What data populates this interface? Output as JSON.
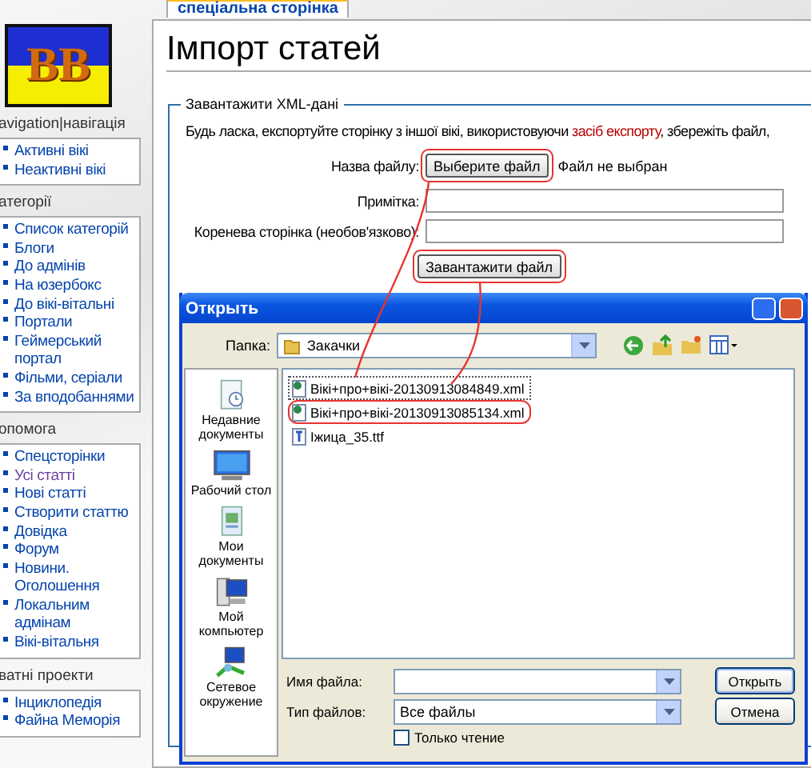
{
  "logo": {
    "text": "BB"
  },
  "sidebar": {
    "sections": [
      {
        "heading": "avigation|навігація",
        "items": [
          {
            "label": "Активні вікі",
            "visited": false
          },
          {
            "label": "Неактивні вікі",
            "visited": false
          }
        ]
      },
      {
        "heading": "атегорії",
        "items": [
          {
            "label": "Список категорій",
            "visited": false
          },
          {
            "label": "Блоги",
            "visited": false
          },
          {
            "label": "До адмінів",
            "visited": false
          },
          {
            "label": "На юзербокс",
            "visited": false
          },
          {
            "label": "До вікі-вітальні",
            "visited": false
          },
          {
            "label": "Портали",
            "visited": false
          },
          {
            "label": "Геймерський портал",
            "visited": false
          },
          {
            "label": "Фільми, серіали",
            "visited": false
          },
          {
            "label": "За вподобаннями",
            "visited": false
          }
        ]
      },
      {
        "heading": "опомога",
        "items": [
          {
            "label": "Спецсторінки",
            "visited": false
          },
          {
            "label": "Усі статті",
            "visited": true
          },
          {
            "label": "Нові статті",
            "visited": false
          },
          {
            "label": "Створити статтю",
            "visited": false
          },
          {
            "label": "Довідка",
            "visited": false
          },
          {
            "label": "Форум",
            "visited": false
          },
          {
            "label": "Новини. Оголошення",
            "visited": false
          },
          {
            "label": "Локальним адмінам",
            "visited": false
          },
          {
            "label": "Вікі-вітальня",
            "visited": false
          }
        ]
      },
      {
        "heading": "ватні проекти",
        "items": [
          {
            "label": "Інциклопедія",
            "visited": false
          },
          {
            "label": "Файна Меморія",
            "visited": false
          }
        ]
      }
    ]
  },
  "tabs": [
    {
      "label": "спеціальна сторінка",
      "selected": true
    }
  ],
  "page": {
    "title": "Імпорт статей",
    "fieldset": {
      "legend": "Завантажити XML-дані",
      "intro": {
        "before": "Будь ласка, експортуйте сторінку з іншої вікі, використовуючи ",
        "link": "засіб експорту",
        "after": ", збережіть файл,"
      },
      "rows": [
        {
          "label": "Назва файлу:",
          "kind": "file",
          "button": "Выберите файл",
          "status": "Файл не выбран",
          "highlighted": true
        },
        {
          "label": "Примітка:",
          "kind": "text"
        },
        {
          "label": "Коренева сторінка (необов'язково):",
          "kind": "text"
        }
      ],
      "submit": {
        "label": "Завантажити файл",
        "highlighted": true
      }
    }
  },
  "dialog": {
    "title": "Открыть",
    "folder_label": "Папка:",
    "folder": "Закачки",
    "places": [
      {
        "label": "Недавние документы",
        "kind": "recent"
      },
      {
        "label": "Рабочий стол",
        "kind": "desktop"
      },
      {
        "label": "Мои документы",
        "kind": "documents"
      },
      {
        "label": "Мой компьютер",
        "kind": "computer"
      },
      {
        "label": "Сетевое окружение",
        "kind": "network"
      }
    ],
    "files": [
      {
        "name": "Вікі+про+вікі-20130913084849.xml",
        "kind": "xml",
        "focused": true,
        "highlighted": false
      },
      {
        "name": "Вікі+про+вікі-20130913085134.xml",
        "kind": "xml",
        "focused": false,
        "highlighted": true
      },
      {
        "name": "Іжица_35.ttf",
        "kind": "font",
        "focused": false,
        "highlighted": false
      }
    ],
    "file_name_label": "Имя файла:",
    "file_type_label": "Тип файлов:",
    "file_type": "Все файлы",
    "read_only": {
      "label": "Только чтение",
      "checked": false
    },
    "buttons": [
      {
        "label": "Открыть",
        "default": true
      },
      {
        "label": "Отмена",
        "default": false
      }
    ]
  }
}
